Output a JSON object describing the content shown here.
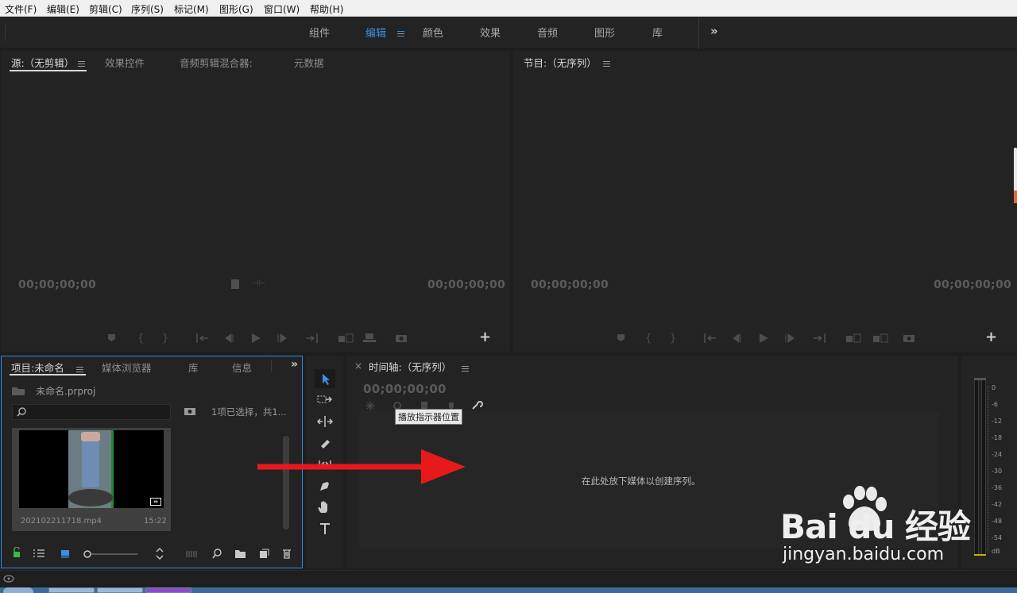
{
  "menu": [
    "文件(F)",
    "编辑(E)",
    "剪辑(C)",
    "序列(S)",
    "标记(M)",
    "图形(G)",
    "窗口(W)",
    "帮助(H)"
  ],
  "workspaces": [
    "组件",
    "编辑",
    "颜色",
    "效果",
    "音频",
    "图形",
    "库"
  ],
  "source_panel": {
    "tabs": [
      "源:（无剪辑）",
      "效果控件",
      "音频剪辑混合器:",
      "元数据"
    ],
    "timecode_left": "00;00;00;00",
    "timecode_right": "00;00;00;00"
  },
  "program_panel": {
    "tab": "节目:（无序列）",
    "timecode_left": "00;00;00;00",
    "timecode_right": "00;00;00;00"
  },
  "project_panel": {
    "tabs": [
      "项目:未命名",
      "媒体浏览器",
      "库",
      "信息"
    ],
    "project_file": "未命名.prproj",
    "selection_info": "1项已选择，共1...",
    "clip": {
      "name": "202102211718.mp4",
      "duration": "15:22"
    }
  },
  "timeline_panel": {
    "tab": "时间轴:（无序列）",
    "timecode": "00;00;00;00",
    "tooltip": "播放指示器位置",
    "empty_message": "在此处放下媒体以创建序列。"
  },
  "audio_meter": {
    "labels": [
      "0",
      "-6",
      "-12",
      "-18",
      "-24",
      "-30",
      "-36",
      "-42",
      "-48",
      "-54",
      "dB"
    ]
  },
  "watermark": {
    "brand": "Bai du 经验",
    "url": "jingyan.baidu.com"
  },
  "colors": {
    "accent": "#3d8ee8",
    "panel_bg": "#232323",
    "arrow": "#e8191b"
  }
}
